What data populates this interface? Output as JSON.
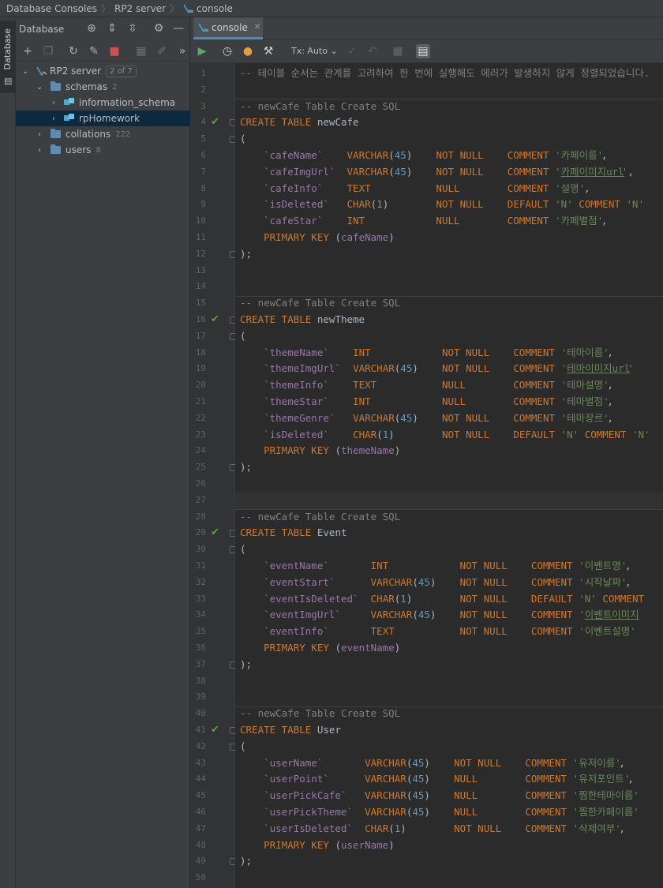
{
  "breadcrumb": [
    "Database Consoles",
    "RP2 server",
    "console"
  ],
  "left_strip": {
    "database_tab": "Database"
  },
  "db_panel": {
    "title": "Database",
    "tree": [
      {
        "label": "RP2 server",
        "badge": "2 of 7",
        "depth": 0,
        "kind": "server",
        "expanded": true
      },
      {
        "label": "schemas",
        "count": "2",
        "depth": 1,
        "kind": "folder",
        "expanded": true
      },
      {
        "label": "information_schema",
        "depth": 2,
        "kind": "schema",
        "expanded": false
      },
      {
        "label": "rpHomework",
        "depth": 2,
        "kind": "schema",
        "expanded": false,
        "selected": true
      },
      {
        "label": "collations",
        "count": "222",
        "depth": 1,
        "kind": "folder",
        "expanded": false
      },
      {
        "label": "users",
        "count": "8",
        "depth": 1,
        "kind": "folder",
        "expanded": false
      }
    ]
  },
  "editor": {
    "tab_label": "console",
    "tx_mode": "Tx: Auto",
    "caret_line": 27,
    "checked_lines": [
      4,
      16,
      29,
      41
    ],
    "fold_lines": [
      4,
      5,
      12,
      16,
      17,
      25,
      29,
      30,
      37,
      41,
      42,
      49
    ],
    "separator_after_lines": [
      2,
      14,
      27,
      39
    ],
    "lines": [
      [
        [
          "c-com",
          "-- 테이블 순서는 관계를 고려하여 한 번에 실행해도 에러가 발생하지 않게 정렬되었습니다."
        ]
      ],
      [],
      [
        [
          "c-com",
          "-- newCafe Table Create SQL"
        ]
      ],
      [
        [
          "c-kw",
          "CREATE TABLE "
        ],
        [
          "c-id",
          "newCafe"
        ]
      ],
      [
        [
          "c-id",
          "("
        ]
      ],
      [
        [
          "c-col",
          "    `cafeName`    "
        ],
        [
          "c-kw",
          "VARCHAR"
        ],
        [
          "c-id",
          "("
        ],
        [
          "c-num",
          "45"
        ],
        [
          "c-id",
          ")    "
        ],
        [
          "c-kw",
          "NOT NULL    COMMENT "
        ],
        [
          "c-str",
          "'카페이름'"
        ],
        [
          "c-id",
          ","
        ]
      ],
      [
        [
          "c-col",
          "    `cafeImgUrl`  "
        ],
        [
          "c-kw",
          "VARCHAR"
        ],
        [
          "c-id",
          "("
        ],
        [
          "c-num",
          "45"
        ],
        [
          "c-id",
          ")    "
        ],
        [
          "c-kw",
          "NOT NULL    COMMENT "
        ],
        [
          "c-str",
          "'"
        ],
        [
          "c-url",
          "카페이미지url"
        ],
        [
          "c-str",
          "'"
        ],
        [
          "c-id",
          ","
        ]
      ],
      [
        [
          "c-col",
          "    `cafeInfo`    "
        ],
        [
          "c-kw",
          "TEXT           NULL        COMMENT "
        ],
        [
          "c-str",
          "'설명'"
        ],
        [
          "c-id",
          ","
        ]
      ],
      [
        [
          "c-col",
          "    `isDeleted`   "
        ],
        [
          "c-kw",
          "CHAR"
        ],
        [
          "c-id",
          "("
        ],
        [
          "c-num",
          "1"
        ],
        [
          "c-id",
          ")        "
        ],
        [
          "c-kw",
          "NOT NULL    DEFAULT "
        ],
        [
          "c-str",
          "'N'"
        ],
        [
          "c-kw",
          " COMMENT "
        ],
        [
          "c-str",
          "'N'"
        ]
      ],
      [
        [
          "c-col",
          "    `cafeStar`    "
        ],
        [
          "c-kw",
          "INT            NULL        COMMENT "
        ],
        [
          "c-str",
          "'카페별점'"
        ],
        [
          "c-id",
          ","
        ]
      ],
      [
        [
          "c-kw",
          "    PRIMARY KEY "
        ],
        [
          "c-id",
          "("
        ],
        [
          "c-col",
          "cafeName"
        ],
        [
          "c-id",
          ")"
        ]
      ],
      [
        [
          "c-id",
          ");"
        ]
      ],
      [],
      [],
      [
        [
          "c-com",
          "-- newCafe Table Create SQL"
        ]
      ],
      [
        [
          "c-kw",
          "CREATE TABLE "
        ],
        [
          "c-id",
          "newTheme"
        ]
      ],
      [
        [
          "c-id",
          "("
        ]
      ],
      [
        [
          "c-col",
          "    `themeName`    "
        ],
        [
          "c-kw",
          "INT            NOT NULL    COMMENT "
        ],
        [
          "c-str",
          "'테마이름'"
        ],
        [
          "c-id",
          ","
        ]
      ],
      [
        [
          "c-col",
          "    `themeImgUrl`  "
        ],
        [
          "c-kw",
          "VARCHAR"
        ],
        [
          "c-id",
          "("
        ],
        [
          "c-num",
          "45"
        ],
        [
          "c-id",
          ")    "
        ],
        [
          "c-kw",
          "NOT NULL    COMMENT "
        ],
        [
          "c-str",
          "'"
        ],
        [
          "c-url",
          "테마이미지url"
        ],
        [
          "c-str",
          "'"
        ]
      ],
      [
        [
          "c-col",
          "    `themeInfo`    "
        ],
        [
          "c-kw",
          "TEXT           NULL        COMMENT "
        ],
        [
          "c-str",
          "'테마설명'"
        ],
        [
          "c-id",
          ","
        ]
      ],
      [
        [
          "c-col",
          "    `themeStar`    "
        ],
        [
          "c-kw",
          "INT            NULL        COMMENT "
        ],
        [
          "c-str",
          "'테마별점'"
        ],
        [
          "c-id",
          ","
        ]
      ],
      [
        [
          "c-col",
          "    `themeGenre`   "
        ],
        [
          "c-kw",
          "VARCHAR"
        ],
        [
          "c-id",
          "("
        ],
        [
          "c-num",
          "45"
        ],
        [
          "c-id",
          ")    "
        ],
        [
          "c-kw",
          "NOT NULL    COMMENT "
        ],
        [
          "c-str",
          "'테마장르'"
        ],
        [
          "c-id",
          ","
        ]
      ],
      [
        [
          "c-col",
          "    `isDeleted`    "
        ],
        [
          "c-kw",
          "CHAR"
        ],
        [
          "c-id",
          "("
        ],
        [
          "c-num",
          "1"
        ],
        [
          "c-id",
          ")        "
        ],
        [
          "c-kw",
          "NOT NULL    DEFAULT "
        ],
        [
          "c-str",
          "'N'"
        ],
        [
          "c-kw",
          " COMMENT "
        ],
        [
          "c-str",
          "'N'"
        ]
      ],
      [
        [
          "c-kw",
          "    PRIMARY KEY "
        ],
        [
          "c-id",
          "("
        ],
        [
          "c-col",
          "themeName"
        ],
        [
          "c-id",
          ")"
        ]
      ],
      [
        [
          "c-id",
          ");"
        ]
      ],
      [],
      [],
      [
        [
          "c-com",
          "-- newCafe Table Create SQL"
        ]
      ],
      [
        [
          "c-kw",
          "CREATE TABLE "
        ],
        [
          "c-id",
          "Event"
        ]
      ],
      [
        [
          "c-id",
          "("
        ]
      ],
      [
        [
          "c-col",
          "    `eventName`       "
        ],
        [
          "c-kw",
          "INT            NOT NULL    COMMENT "
        ],
        [
          "c-str",
          "'이벤트명'"
        ],
        [
          "c-id",
          ","
        ]
      ],
      [
        [
          "c-col",
          "    `eventStart`      "
        ],
        [
          "c-kw",
          "VARCHAR"
        ],
        [
          "c-id",
          "("
        ],
        [
          "c-num",
          "45"
        ],
        [
          "c-id",
          ")    "
        ],
        [
          "c-kw",
          "NOT NULL    COMMENT "
        ],
        [
          "c-str",
          "'시작날짜'"
        ],
        [
          "c-id",
          ","
        ]
      ],
      [
        [
          "c-col",
          "    `eventIsDeleted`  "
        ],
        [
          "c-kw",
          "CHAR"
        ],
        [
          "c-id",
          "("
        ],
        [
          "c-num",
          "1"
        ],
        [
          "c-id",
          ")        "
        ],
        [
          "c-kw",
          "NOT NULL    DEFAULT "
        ],
        [
          "c-str",
          "'N'"
        ],
        [
          "c-kw",
          " COMMENT"
        ]
      ],
      [
        [
          "c-col",
          "    `eventImgUrl`     "
        ],
        [
          "c-kw",
          "VARCHAR"
        ],
        [
          "c-id",
          "("
        ],
        [
          "c-num",
          "45"
        ],
        [
          "c-id",
          ")    "
        ],
        [
          "c-kw",
          "NOT NULL    COMMENT "
        ],
        [
          "c-str",
          "'"
        ],
        [
          "c-url",
          "이벤트이미지"
        ]
      ],
      [
        [
          "c-col",
          "    `eventInfo`       "
        ],
        [
          "c-kw",
          "TEXT           NOT NULL    COMMENT "
        ],
        [
          "c-str",
          "'이벤트설명'"
        ]
      ],
      [
        [
          "c-kw",
          "    PRIMARY KEY "
        ],
        [
          "c-id",
          "("
        ],
        [
          "c-col",
          "eventName"
        ],
        [
          "c-id",
          ")"
        ]
      ],
      [
        [
          "c-id",
          ");"
        ]
      ],
      [],
      [],
      [
        [
          "c-com",
          "-- newCafe Table Create SQL"
        ]
      ],
      [
        [
          "c-kw",
          "CREATE TABLE "
        ],
        [
          "c-id",
          "User"
        ]
      ],
      [
        [
          "c-id",
          "("
        ]
      ],
      [
        [
          "c-col",
          "    `userName`       "
        ],
        [
          "c-kw",
          "VARCHAR"
        ],
        [
          "c-id",
          "("
        ],
        [
          "c-num",
          "45"
        ],
        [
          "c-id",
          ")    "
        ],
        [
          "c-kw",
          "NOT NULL    COMMENT "
        ],
        [
          "c-str",
          "'유저이름'"
        ],
        [
          "c-id",
          ","
        ]
      ],
      [
        [
          "c-col",
          "    `userPoint`      "
        ],
        [
          "c-kw",
          "VARCHAR"
        ],
        [
          "c-id",
          "("
        ],
        [
          "c-num",
          "45"
        ],
        [
          "c-id",
          ")    "
        ],
        [
          "c-kw",
          "NULL        COMMENT "
        ],
        [
          "c-str",
          "'유저포인트'"
        ],
        [
          "c-id",
          ","
        ]
      ],
      [
        [
          "c-col",
          "    `userPickCafe`   "
        ],
        [
          "c-kw",
          "VARCHAR"
        ],
        [
          "c-id",
          "("
        ],
        [
          "c-num",
          "45"
        ],
        [
          "c-id",
          ")    "
        ],
        [
          "c-kw",
          "NULL        COMMENT "
        ],
        [
          "c-str",
          "'찜한테마이름'"
        ]
      ],
      [
        [
          "c-col",
          "    `userPickTheme`  "
        ],
        [
          "c-kw",
          "VARCHAR"
        ],
        [
          "c-id",
          "("
        ],
        [
          "c-num",
          "45"
        ],
        [
          "c-id",
          ")    "
        ],
        [
          "c-kw",
          "NULL        COMMENT "
        ],
        [
          "c-str",
          "'찜한카페이름'"
        ]
      ],
      [
        [
          "c-col",
          "    `userIsDeleted`  "
        ],
        [
          "c-kw",
          "CHAR"
        ],
        [
          "c-id",
          "("
        ],
        [
          "c-num",
          "1"
        ],
        [
          "c-id",
          ")        "
        ],
        [
          "c-kw",
          "NOT NULL    COMMENT "
        ],
        [
          "c-str",
          "'삭제여부'"
        ],
        [
          "c-id",
          ","
        ]
      ],
      [
        [
          "c-kw",
          "    PRIMARY KEY "
        ],
        [
          "c-id",
          "("
        ],
        [
          "c-col",
          "userName"
        ],
        [
          "c-id",
          ")"
        ]
      ],
      [
        [
          "c-id",
          ");"
        ]
      ],
      []
    ]
  },
  "colors": {
    "keyword": "#cc7832",
    "column": "#9876aa",
    "number": "#6897bb",
    "string": "#6a8759",
    "comment": "#808080",
    "check": "#5aa14a",
    "selection": "#0d293e"
  },
  "icons": [
    "locate-icon",
    "expand-all-icon",
    "collapse-all-icon",
    "settings-icon",
    "minimize-icon",
    "add-icon",
    "duplicate-icon",
    "refresh-icon",
    "edit-properties-icon",
    "stop-icon",
    "table-view-icon",
    "edit-icon",
    "more-icon",
    "run-icon",
    "history-icon",
    "pin-icon",
    "wrench-icon",
    "commit-icon",
    "rollback-icon",
    "cancel-icon",
    "output-icon"
  ]
}
